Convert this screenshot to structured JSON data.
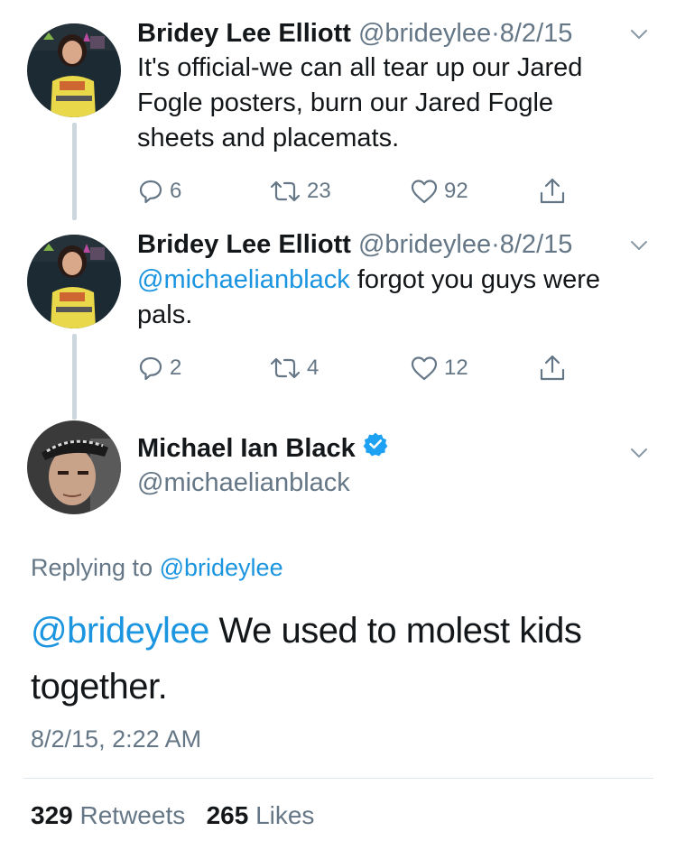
{
  "tweets": [
    {
      "name": "Bridey Lee Elliott",
      "handle": "@brideylee",
      "separator": "·",
      "date": "8/2/15",
      "text_lines": [
        "It's official-we can all tear up our Jared",
        "Fogle posters, burn our Jared Fogle",
        "sheets and placemats."
      ],
      "replies": "6",
      "retweets": "23",
      "likes": "92",
      "avatar_icon": "user-avatar-bridey"
    },
    {
      "name": "Bridey Lee Elliott",
      "handle": "@brideylee",
      "separator": "·",
      "date": "8/2/15",
      "mention": "@michaelianblack",
      "text_after_mention": " forgot you guys were",
      "text_line2": "pals.",
      "replies": "2",
      "retweets": "4",
      "likes": "12",
      "avatar_icon": "user-avatar-bridey"
    }
  ],
  "main_tweet": {
    "name": "Michael Ian Black",
    "handle": "@michaelianblack",
    "verified": true,
    "replying_prefix": "Replying to",
    "replying_to": "@brideylee",
    "mention": "@brideylee",
    "text_after_mention": " We used to molest kids",
    "text_line2": "together.",
    "timestamp": "8/2/15, 2:22 AM",
    "retweets_count": "329",
    "retweets_label": "Retweets",
    "likes_count": "265",
    "likes_label": "Likes",
    "avatar_icon": "user-avatar-michael"
  },
  "colors": {
    "link": "#1b95e0",
    "secondary": "#657786",
    "thread_line": "#ccd6dd",
    "verified": "#1da1f2"
  }
}
